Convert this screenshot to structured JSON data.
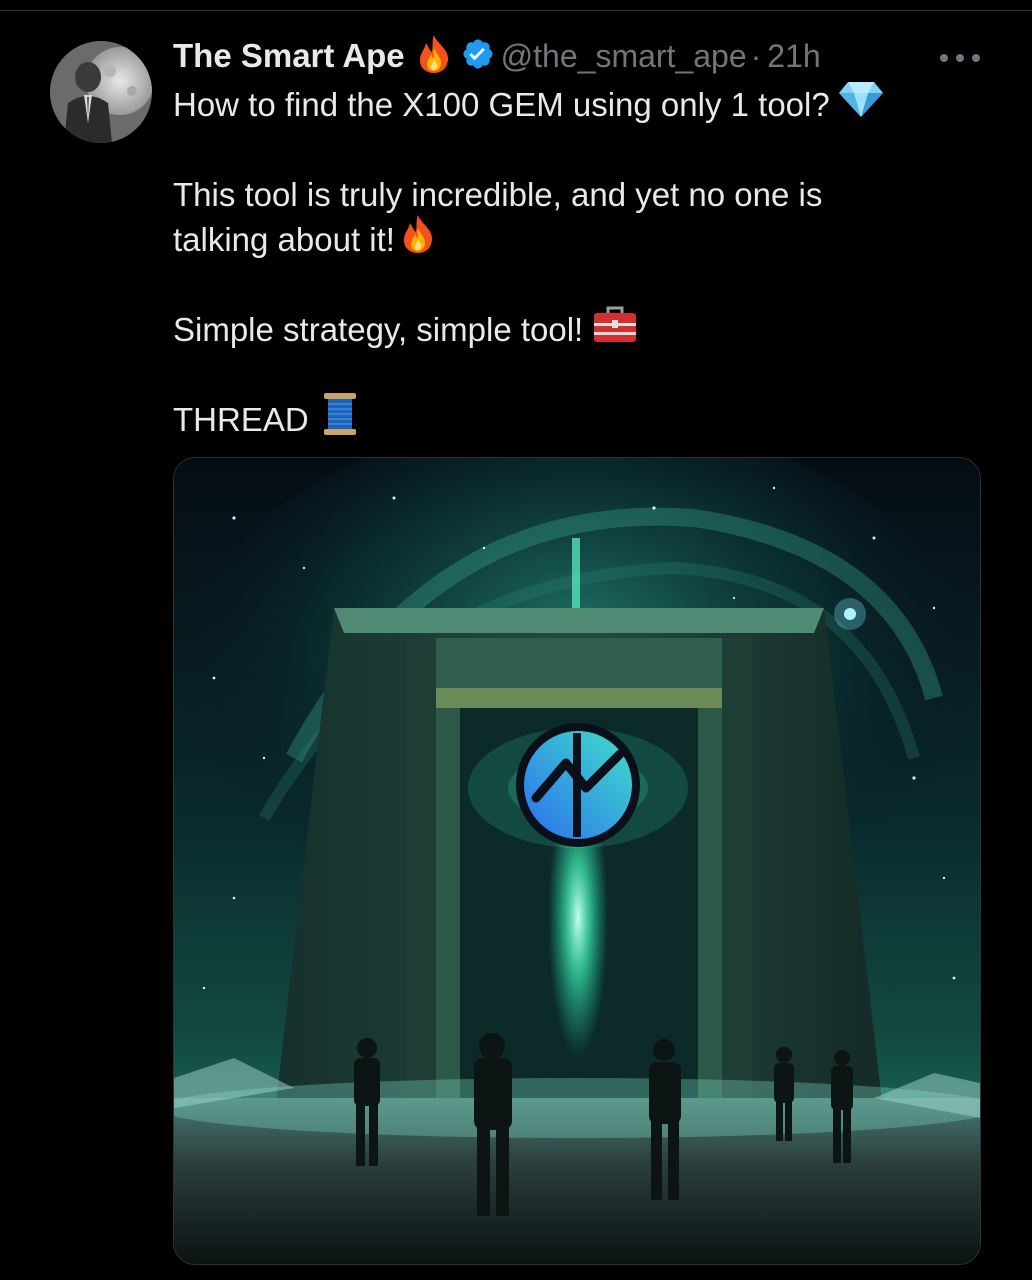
{
  "tweet": {
    "display_name": "The Smart Ape",
    "handle": "@the_smart_ape",
    "separator": "·",
    "time": "21h",
    "lines": [
      "How to find the X100 GEM using only 1 tool?",
      "This tool is truly incredible, and yet no one is",
      "talking about it!",
      "Simple strategy, simple tool!",
      "THREAD"
    ],
    "icons": {
      "name_emoji": "fire-emoji-icon",
      "verified": "verified-badge-icon",
      "line1_emoji": "gem-emoji-icon",
      "line3_emoji": "fire-emoji-icon",
      "line4_emoji": "toolbox-emoji-icon",
      "line5_emoji": "spool-of-thread-emoji-icon",
      "more": "more-options-icon"
    }
  },
  "colors": {
    "background": "#000000",
    "text": "#e7e9ea",
    "secondary_text": "#71767b",
    "verified_blue": "#1d9bf0",
    "accent_teal": "#1fd1a0"
  }
}
